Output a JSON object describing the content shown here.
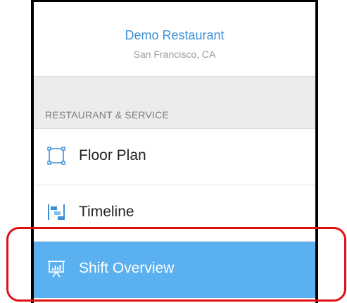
{
  "header": {
    "restaurant_name": "Demo Restaurant",
    "location": "San Francisco, CA"
  },
  "section": {
    "title": "RESTAURANT & SERVICE"
  },
  "menu": {
    "items": [
      {
        "label": "Floor Plan",
        "icon": "floor-plan-icon",
        "selected": false
      },
      {
        "label": "Timeline",
        "icon": "timeline-icon",
        "selected": false
      },
      {
        "label": "Shift Overview",
        "icon": "presentation-chart-icon",
        "selected": true
      }
    ]
  },
  "colors": {
    "accent": "#3d8fd6",
    "selected_background": "#5bb0f0",
    "highlight_outline": "#e01010"
  }
}
